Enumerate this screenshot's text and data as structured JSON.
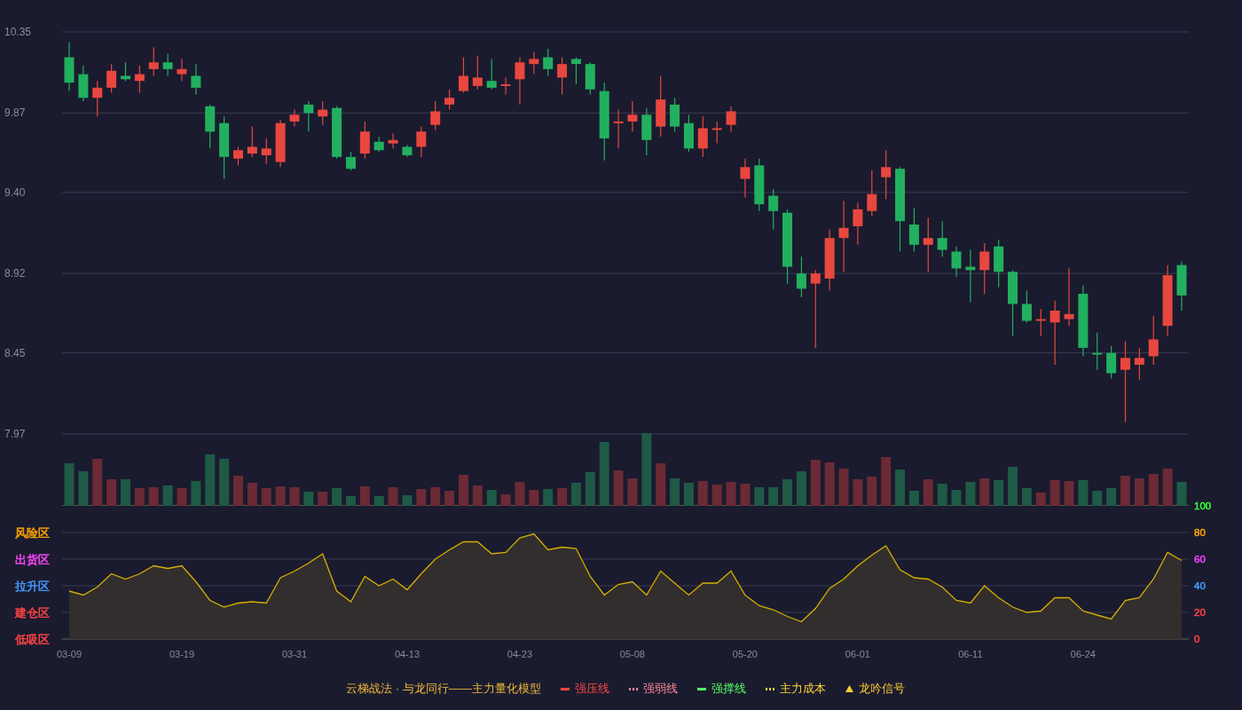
{
  "price_panel": {
    "chart_data": {
      "type": "candlestick",
      "ylim": [
        7.97,
        10.35
      ],
      "yticks": [
        {
          "value": 10.35,
          "label": "10.35"
        },
        {
          "value": 9.87,
          "label": "9.87"
        },
        {
          "value": 9.4,
          "label": "9.40"
        },
        {
          "value": 8.92,
          "label": "8.92"
        },
        {
          "value": 8.45,
          "label": "8.45"
        },
        {
          "value": 7.97,
          "label": "7.97"
        }
      ],
      "grid": true,
      "categories": [
        null,
        null,
        null,
        null,
        null,
        null,
        null,
        null,
        null,
        null,
        null,
        null,
        null,
        null,
        null,
        null,
        null,
        null,
        null,
        null,
        null,
        null,
        null,
        null,
        null,
        null,
        null,
        null,
        null,
        null,
        null,
        null,
        null,
        null,
        null,
        null,
        null,
        null,
        null,
        null,
        null,
        null,
        null,
        null,
        null,
        null,
        null,
        null,
        null,
        null,
        null,
        null,
        null,
        null,
        null,
        null,
        null,
        null,
        null,
        null,
        null,
        null,
        null,
        null,
        null,
        null,
        null,
        null,
        null,
        null,
        null,
        null,
        null,
        null,
        null,
        null,
        null,
        null,
        null,
        null
      ],
      "ohlc": [
        [
          10.2,
          10.29,
          10.0,
          10.05
        ],
        [
          10.1,
          10.15,
          9.94,
          9.96
        ],
        [
          9.96,
          10.06,
          9.85,
          10.02
        ],
        [
          10.02,
          10.16,
          9.99,
          10.12
        ],
        [
          10.09,
          10.17,
          10.06,
          10.07
        ],
        [
          10.06,
          10.15,
          9.99,
          10.1
        ],
        [
          10.13,
          10.26,
          10.09,
          10.17
        ],
        [
          10.17,
          10.22,
          10.09,
          10.13
        ],
        [
          10.1,
          10.19,
          10.06,
          10.13
        ],
        [
          10.09,
          10.16,
          9.98,
          10.02
        ],
        [
          9.91,
          9.92,
          9.66,
          9.76
        ],
        [
          9.81,
          9.85,
          9.48,
          9.61
        ],
        [
          9.6,
          9.67,
          9.56,
          9.65
        ],
        [
          9.63,
          9.79,
          9.61,
          9.67
        ],
        [
          9.62,
          9.72,
          9.57,
          9.66
        ],
        [
          9.58,
          9.83,
          9.55,
          9.81
        ],
        [
          9.82,
          9.89,
          9.79,
          9.86
        ],
        [
          9.92,
          9.94,
          9.76,
          9.87
        ],
        [
          9.85,
          9.94,
          9.8,
          9.89
        ],
        [
          9.9,
          9.91,
          9.6,
          9.61
        ],
        [
          9.61,
          9.64,
          9.53,
          9.54
        ],
        [
          9.63,
          9.82,
          9.6,
          9.76
        ],
        [
          9.7,
          9.73,
          9.64,
          9.65
        ],
        [
          9.69,
          9.75,
          9.66,
          9.71
        ],
        [
          9.67,
          9.68,
          9.61,
          9.62
        ],
        [
          9.67,
          9.79,
          9.61,
          9.76
        ],
        [
          9.8,
          9.94,
          9.77,
          9.88
        ],
        [
          9.92,
          10.01,
          9.89,
          9.96
        ],
        [
          10.0,
          10.2,
          9.99,
          10.09
        ],
        [
          10.03,
          10.21,
          10.01,
          10.08
        ],
        [
          10.06,
          10.19,
          10.01,
          10.02
        ],
        [
          10.03,
          10.08,
          9.98,
          10.04
        ],
        [
          10.07,
          10.2,
          9.92,
          10.17
        ],
        [
          10.16,
          10.23,
          10.1,
          10.19
        ],
        [
          10.2,
          10.25,
          10.09,
          10.13
        ],
        [
          10.08,
          10.2,
          9.98,
          10.16
        ],
        [
          10.19,
          10.2,
          10.04,
          10.16
        ],
        [
          10.16,
          10.17,
          9.98,
          10.01
        ],
        [
          10.0,
          10.05,
          9.59,
          9.72
        ],
        [
          9.81,
          9.89,
          9.66,
          9.82
        ],
        [
          9.82,
          9.94,
          9.76,
          9.86
        ],
        [
          9.86,
          9.9,
          9.62,
          9.71
        ],
        [
          9.79,
          10.09,
          9.73,
          9.95
        ],
        [
          9.92,
          9.96,
          9.76,
          9.79
        ],
        [
          9.81,
          9.86,
          9.64,
          9.66
        ],
        [
          9.66,
          9.85,
          9.61,
          9.78
        ],
        [
          9.77,
          9.82,
          9.69,
          9.78
        ],
        [
          9.8,
          9.91,
          9.76,
          9.88
        ],
        [
          9.48,
          9.6,
          9.37,
          9.55
        ],
        [
          9.56,
          9.6,
          9.29,
          9.33
        ],
        [
          9.38,
          9.42,
          9.18,
          9.29
        ],
        [
          9.28,
          9.3,
          8.86,
          8.96
        ],
        [
          8.92,
          9.02,
          8.78,
          8.83
        ],
        [
          8.86,
          8.94,
          8.48,
          8.92
        ],
        [
          8.89,
          9.18,
          8.82,
          9.13
        ],
        [
          9.13,
          9.35,
          8.93,
          9.19
        ],
        [
          9.2,
          9.34,
          9.09,
          9.3
        ],
        [
          9.29,
          9.53,
          9.26,
          9.39
        ],
        [
          9.49,
          9.65,
          9.36,
          9.55
        ],
        [
          9.54,
          9.55,
          9.05,
          9.23
        ],
        [
          9.21,
          9.31,
          9.05,
          9.09
        ],
        [
          9.09,
          9.25,
          8.93,
          9.13
        ],
        [
          9.13,
          9.23,
          9.02,
          9.06
        ],
        [
          9.05,
          9.08,
          8.9,
          8.95
        ],
        [
          8.96,
          9.06,
          8.75,
          8.94
        ],
        [
          8.94,
          9.1,
          8.8,
          9.05
        ],
        [
          9.08,
          9.12,
          8.84,
          8.93
        ],
        [
          8.93,
          8.94,
          8.55,
          8.74
        ],
        [
          8.74,
          8.82,
          8.63,
          8.64
        ],
        [
          8.64,
          8.71,
          8.55,
          8.65
        ],
        [
          8.63,
          8.76,
          8.38,
          8.7
        ],
        [
          8.65,
          8.95,
          8.61,
          8.68
        ],
        [
          8.8,
          8.85,
          8.43,
          8.48
        ],
        [
          8.45,
          8.57,
          8.35,
          8.44
        ],
        [
          8.45,
          8.49,
          8.3,
          8.33
        ],
        [
          8.35,
          8.52,
          8.04,
          8.42
        ],
        [
          8.38,
          8.48,
          8.29,
          8.42
        ],
        [
          8.43,
          8.67,
          8.38,
          8.53
        ],
        [
          8.61,
          8.97,
          8.55,
          8.91
        ],
        [
          8.97,
          8.99,
          8.7,
          8.79
        ]
      ]
    }
  },
  "indicator_panel": {
    "zones": [
      {
        "label": "风险区",
        "color": "#ffa500"
      },
      {
        "label": "出货区",
        "color": "#ff44ff"
      },
      {
        "label": "拉升区",
        "color": "#4499ff"
      },
      {
        "label": "建仓区",
        "color": "#ff4444"
      },
      {
        "label": "低吸区",
        "color": "#ff4444"
      }
    ],
    "axis_labels": [
      {
        "color": "#33ff33"
      },
      {
        "color": "#ffa500"
      },
      {
        "color": "#ff44ff"
      },
      {
        "color": "#4499ff"
      },
      {
        "color": "#ff4444"
      },
      {
        "color": "#ff4444"
      }
    ],
    "chart_data": {
      "type": "area",
      "grid": true,
      "ylim": [
        0,
        100
      ],
      "yticks": [
        {
          "value": 100,
          "label": "100"
        },
        {
          "value": 80,
          "label": "80"
        },
        {
          "value": 60,
          "label": "60"
        },
        {
          "value": 40,
          "label": "40"
        },
        {
          "value": 20,
          "label": "20"
        },
        {
          "value": 0,
          "label": "0"
        }
      ],
      "categories": [
        "03-09",
        null,
        null,
        null,
        null,
        null,
        null,
        null,
        "03-19",
        null,
        null,
        null,
        null,
        null,
        null,
        null,
        "03-31",
        null,
        null,
        null,
        null,
        null,
        null,
        null,
        "04-13",
        null,
        null,
        null,
        null,
        null,
        null,
        null,
        "04-23",
        null,
        null,
        null,
        null,
        null,
        null,
        null,
        "05-08",
        null,
        null,
        null,
        null,
        null,
        null,
        null,
        "05-20",
        null,
        null,
        null,
        null,
        null,
        null,
        null,
        "06-01",
        null,
        null,
        null,
        null,
        null,
        null,
        null,
        "06-11",
        null,
        null,
        null,
        null,
        null,
        null,
        null,
        "06-24",
        null,
        null,
        null,
        null,
        null,
        null,
        null
      ],
      "series": [
        {
          "color": "#d4b000",
          "values": [
            36,
            33,
            39,
            49,
            45,
            49,
            55,
            53,
            55,
            43,
            29,
            24,
            27,
            28,
            27,
            46,
            51,
            57,
            64,
            36,
            28,
            47,
            40,
            45,
            37,
            49,
            60,
            67,
            73,
            73,
            64,
            65,
            76,
            79,
            67,
            69,
            68,
            47,
            33,
            41,
            43,
            33,
            51,
            42,
            33,
            42,
            42,
            51,
            33,
            25,
            22,
            17,
            13,
            23,
            38,
            45,
            55,
            63,
            70,
            52,
            46,
            45,
            39,
            29,
            27,
            40,
            31,
            24,
            20,
            21,
            31,
            31,
            21,
            18,
            15,
            29,
            31,
            45,
            65,
            59
          ]
        }
      ]
    }
  },
  "legend": {
    "title": "云梯战法 · 与龙同行——主力量化模型",
    "items": [
      {
        "label": "强压线",
        "kind": "solid",
        "color": "#ff4444"
      },
      {
        "label": "强弱线",
        "kind": "dashed",
        "color": "#ff8899"
      },
      {
        "label": "强撑线",
        "kind": "solid",
        "color": "#55ff66"
      },
      {
        "label": "主力成本",
        "kind": "dashed",
        "color": "#ffd633"
      },
      {
        "label": "龙吟信号",
        "kind": "triangle",
        "color": "#ffcc33"
      }
    ]
  }
}
